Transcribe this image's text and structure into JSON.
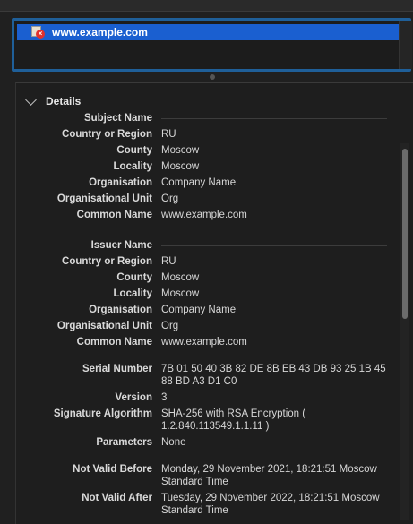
{
  "certificate_list": {
    "selected_item": "www.example.com"
  },
  "details": {
    "title": "Details",
    "subject": {
      "heading": "Subject Name",
      "fields": [
        {
          "label": "Country or Region",
          "value": "RU"
        },
        {
          "label": "County",
          "value": "Moscow"
        },
        {
          "label": "Locality",
          "value": "Moscow"
        },
        {
          "label": "Organisation",
          "value": "Company Name"
        },
        {
          "label": "Organisational Unit",
          "value": "Org"
        },
        {
          "label": "Common Name",
          "value": "www.example.com"
        }
      ]
    },
    "issuer": {
      "heading": "Issuer Name",
      "fields": [
        {
          "label": "Country or Region",
          "value": "RU"
        },
        {
          "label": "County",
          "value": "Moscow"
        },
        {
          "label": "Locality",
          "value": "Moscow"
        },
        {
          "label": "Organisation",
          "value": "Company Name"
        },
        {
          "label": "Organisational Unit",
          "value": "Org"
        },
        {
          "label": "Common Name",
          "value": "www.example.com"
        }
      ]
    },
    "serial_number": {
      "label": "Serial Number",
      "value": "7B 01 50 40 3B 82 DE 8B EB 43 DB 93 25 1B 45 88 BD A3 D1 C0"
    },
    "version": {
      "label": "Version",
      "value": "3"
    },
    "signature_algorithm": {
      "label": "Signature Algorithm",
      "value": "SHA-256 with RSA Encryption ( 1.2.840.113549.1.1.11 )"
    },
    "parameters": {
      "label": "Parameters",
      "value": "None"
    },
    "not_valid_before": {
      "label": "Not Valid Before",
      "value": "Monday, 29 November 2021, 18:21:51 Moscow Standard Time"
    },
    "not_valid_after": {
      "label": "Not Valid After",
      "value": "Tuesday, 29 November 2022, 18:21:51 Moscow Standard Time"
    }
  },
  "icons": {
    "certificate": "certificate-invalid-icon",
    "disclosure": "chevron-down-icon"
  },
  "colors": {
    "selection": "#1a5fd0",
    "focus_ring": "#1f5f99",
    "invalid_badge": "#e0312e"
  }
}
